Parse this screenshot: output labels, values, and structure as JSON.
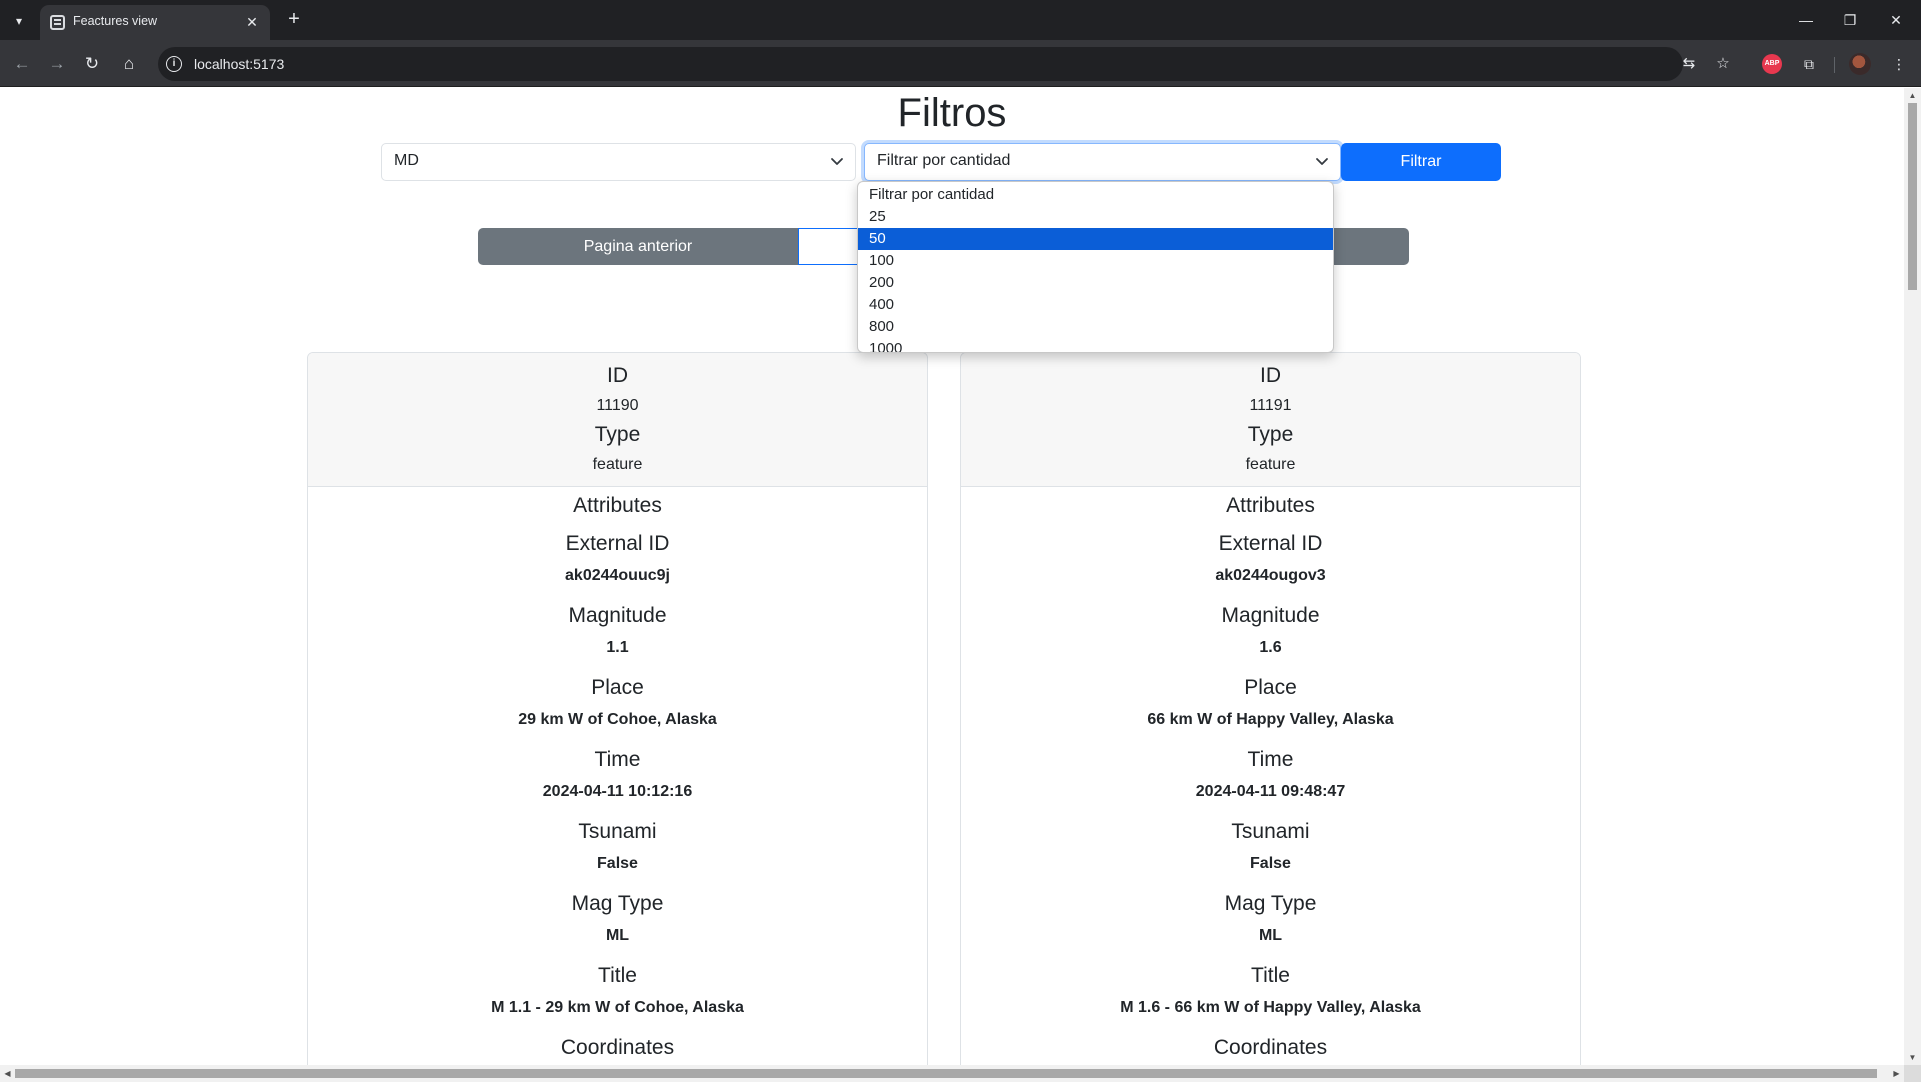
{
  "browser": {
    "tab_title": "Feactures view",
    "url": "localhost:5173",
    "abp_label": "ABP"
  },
  "page": {
    "title": "Filtros",
    "filters": {
      "magtype_value": "MD",
      "quantity_value": "Filtrar por cantidad",
      "filter_button": "Filtrar"
    },
    "quantity_options": [
      {
        "label": "Filtrar por cantidad",
        "selected": false
      },
      {
        "label": "25",
        "selected": false
      },
      {
        "label": "50",
        "selected": true
      },
      {
        "label": "100",
        "selected": false
      },
      {
        "label": "200",
        "selected": false
      },
      {
        "label": "400",
        "selected": false
      },
      {
        "label": "800",
        "selected": false
      },
      {
        "label": "1000",
        "selected": false
      }
    ],
    "pager": {
      "prev_label": "Pagina anterior"
    },
    "field_labels": {
      "id": "ID",
      "type": "Type",
      "attributes": "Attributes",
      "external_id": "External ID",
      "magnitude": "Magnitude",
      "place": "Place",
      "time": "Time",
      "tsunami": "Tsunami",
      "mag_type": "Mag Type",
      "title": "Title",
      "coordinates": "Coordinates"
    },
    "features": [
      {
        "id": "11190",
        "type": "feature",
        "external_id": "ak0244ouuc9j",
        "magnitude": "1.1",
        "place": "29 km W of Cohoe, Alaska",
        "time": "2024-04-11 10:12:16",
        "tsunami": "False",
        "mag_type": "ML",
        "title": "M 1.1 - 29 km W of Cohoe, Alaska"
      },
      {
        "id": "11191",
        "type": "feature",
        "external_id": "ak0244ougov3",
        "magnitude": "1.6",
        "place": "66 km W of Happy Valley, Alaska",
        "time": "2024-04-11 09:48:47",
        "tsunami": "False",
        "mag_type": "ML",
        "title": "M 1.6 - 66 km W of Happy Valley, Alaska"
      }
    ]
  },
  "colors": {
    "primary": "#0d6efd",
    "secondary": "#6c757d",
    "selected_option": "#0b5ed7"
  }
}
